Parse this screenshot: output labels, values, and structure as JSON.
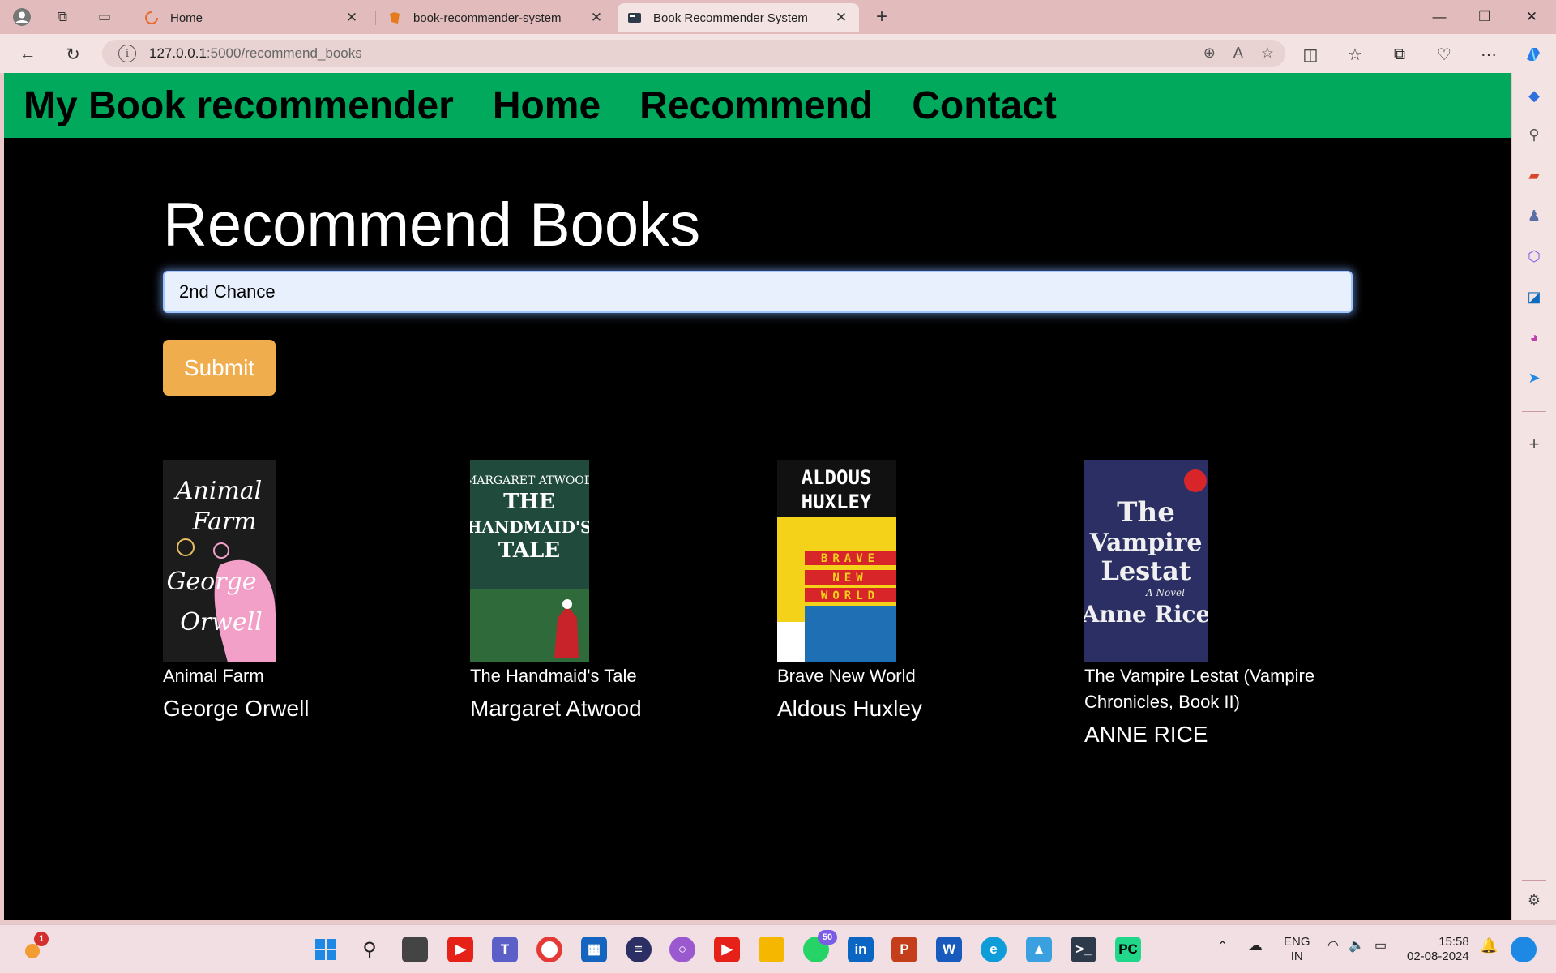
{
  "browser": {
    "tabs": [
      {
        "title": "Home",
        "active": false
      },
      {
        "title": "book-recommender-system",
        "active": false
      },
      {
        "title": "Book Recommender System",
        "active": true
      }
    ],
    "url_host": "127.0.0.1",
    "url_path": ":5000/recommend_books"
  },
  "navbar": {
    "brand": "My Book recommender",
    "links": [
      "Home",
      "Recommend",
      "Contact"
    ]
  },
  "page": {
    "title": "Recommend Books",
    "search_value": "2nd Chance",
    "submit_label": "Submit"
  },
  "books": [
    {
      "title": "Animal Farm",
      "author": "George Orwell",
      "cover_lines": [
        "Animal",
        "Farm",
        "George",
        "Orwell"
      ],
      "cover_colors": {
        "bg": "#1c1c1c",
        "fg": "#ffffff",
        "accent": "#f2a0c8"
      }
    },
    {
      "title": "The Handmaid's Tale",
      "author": "Margaret Atwood",
      "cover_lines": [
        "MARGARET ATWOOD",
        "THE",
        "HANDMAID'S",
        "TALE"
      ],
      "cover_colors": {
        "bg": "#1f4a3c",
        "fg": "#ffffff",
        "accent": "#c8232a"
      }
    },
    {
      "title": "Brave New World",
      "author": "Aldous Huxley",
      "cover_lines": [
        "ALDOUS",
        "HUXLEY",
        "BRAVE",
        "NEW",
        "WORLD"
      ],
      "cover_colors": {
        "bg": "#f5d21a",
        "fg": "#111111",
        "accent": "#d7252a"
      }
    },
    {
      "title": "The Vampire Lestat (Vampire Chronicles, Book II)",
      "author": "ANNE RICE",
      "cover_lines": [
        "The",
        "Vampire",
        "Lestat",
        "A Novel",
        "Anne Rice"
      ],
      "cover_colors": {
        "bg": "#2b2f63",
        "fg": "#f0f0f0",
        "accent": "#d7252a"
      }
    }
  ],
  "taskbar": {
    "lang": "ENG",
    "region": "IN",
    "time": "15:58",
    "date": "02-08-2024",
    "badges": {
      "copilot": "1",
      "whatsapp": "50"
    }
  }
}
